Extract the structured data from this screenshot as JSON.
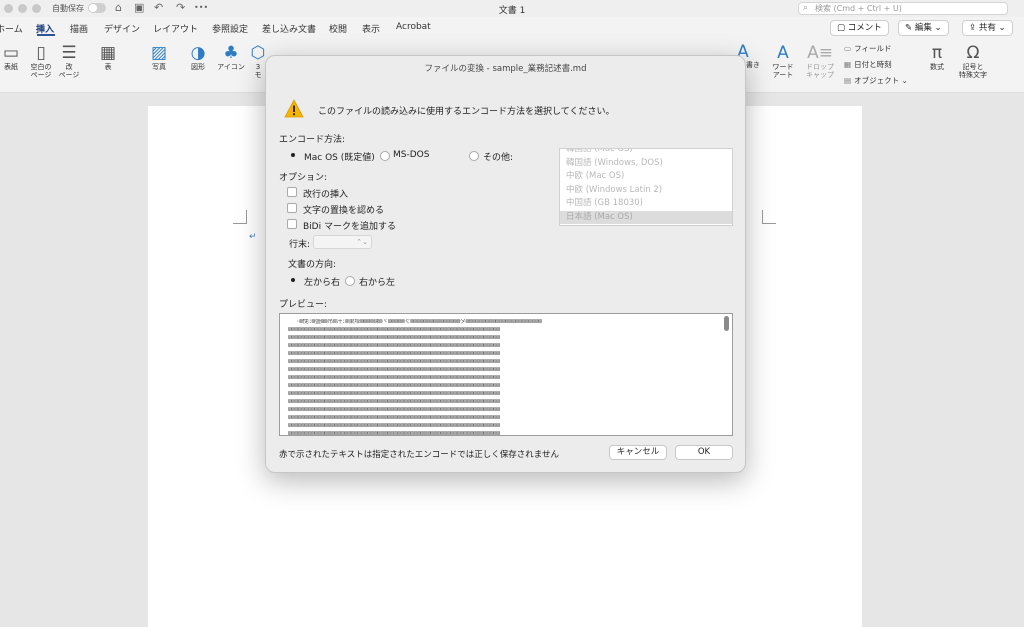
{
  "titlebar": {
    "autosave_label": "自動保存",
    "doc_title": "文書 1",
    "search_placeholder": "検索 (Cmd + Ctrl + U)"
  },
  "tabs": [
    "ホーム",
    "挿入",
    "描画",
    "デザイン",
    "レイアウト",
    "参照設定",
    "差し込み文書",
    "校閲",
    "表示",
    "Acrobat"
  ],
  "active_tab": "挿入",
  "ribbon_buttons": {
    "comment": "コメント",
    "edit": "編集",
    "share": "共有"
  },
  "ribbon": {
    "items": [
      {
        "label": "表紙",
        "icon": "cover-page-icon"
      },
      {
        "label": "空白の\nページ",
        "icon": "blank-page-icon"
      },
      {
        "label": "改\nページ",
        "icon": "page-break-icon"
      },
      {
        "label": "表",
        "icon": "table-icon"
      },
      {
        "label": "写真",
        "icon": "photo-icon"
      },
      {
        "label": "図形",
        "icon": "shapes-icon"
      },
      {
        "label": "アイコン",
        "icon": "icons-icon"
      },
      {
        "label": "3\nモ",
        "icon": "3d-model-icon"
      },
      {
        "label": "書き",
        "icon": "text-box-icon"
      },
      {
        "label": "ワード\nアート",
        "icon": "wordart-icon"
      },
      {
        "label": "ドロップ\nキャップ",
        "icon": "drop-cap-icon"
      },
      {
        "label": "数式",
        "icon": "equation-icon"
      },
      {
        "label": "記号と\n特殊文字",
        "icon": "symbol-icon"
      }
    ],
    "side_items": {
      "field": "フィールド",
      "date_time": "日付と時刻",
      "object": "オブジェクト"
    }
  },
  "dialog": {
    "title": "ファイルの変換 - sample_業務記述書.md",
    "message": "このファイルの読み込みに使用するエンコード方法を選択してください。",
    "encoding_label": "エンコード方法:",
    "encoding_options": [
      "Mac OS (既定値)",
      "MS-DOS",
      "その他:"
    ],
    "encoding_selected": "Mac OS (既定値)",
    "encoding_list": [
      "韓国語 (Mac OS)",
      "韓国語 (Windows, DOS)",
      "中欧 (Mac OS)",
      "中欧 (Windows Latin 2)",
      "中国語 (GB 18030)",
      "日本語 (Mac OS)"
    ],
    "encoding_list_selected": "日本語 (Mac OS)",
    "options_label": "オプション:",
    "options": [
      "改行の挿入",
      "文字の置換を認める",
      "BiDi マークを追加する"
    ],
    "line_end_label": "行末:",
    "direction_label": "文書の方向:",
    "direction_options": [
      "左から右",
      "右から左"
    ],
    "direction_selected": "左から右",
    "preview_label": "プレビュー:",
    "preview_lines": [
      "·⊠俛:⊠盛⊠⊠吊⊠汁:⊠巣埠⊠⊠⊠⊠錬⊠ヾ⊠⊠⊠⊠⊠ぐ⊠⊠⊠⊠⊠⊠⊠⊠⊠⊠⊠⊠⊠⊠⊠ダ⊠⊠⊠⊠⊠⊠⊠⊠⊠⊠⊠⊠⊠⊠⊠⊠⊠⊠⊠⊠⊠⊠⊠",
      "⊠⊠⊠⊠⊠⊠⊠⊠⊠⊠⊠⊠⊠⊠⊠⊠⊠⊠⊠⊠⊠⊠⊠⊠⊠⊠⊠⊠⊠⊠⊠⊠⊠⊠⊠⊠⊠⊠⊠⊠⊠⊠⊠⊠⊠⊠⊠⊠⊠⊠⊠⊠⊠⊠⊠⊠⊠⊠⊠⊠⊠⊠⊠⊠",
      "⊠⊠⊠⊠⊠⊠⊠⊠⊠⊠⊠⊠⊠⊠⊠⊠⊠⊠⊠⊠⊠⊠⊠⊠⊠⊠⊠⊠⊠⊠⊠⊠⊠⊠⊠⊠⊠⊠⊠⊠⊠⊠⊠⊠⊠⊠⊠⊠⊠⊠⊠⊠⊠⊠⊠⊠⊠⊠⊠⊠⊠⊠⊠⊠",
      "⊠⊠⊠⊠⊠⊠⊠⊠⊠⊠⊠⊠⊠⊠⊠⊠⊠⊠⊠⊠⊠⊠⊠⊠⊠⊠⊠⊠⊠⊠⊠⊠⊠⊠⊠⊠⊠⊠⊠⊠⊠⊠⊠⊠⊠⊠⊠⊠⊠⊠⊠⊠⊠⊠⊠⊠⊠⊠⊠⊠⊠⊠⊠⊠",
      "⊠⊠⊠⊠⊠⊠⊠⊠⊠⊠⊠⊠⊠⊠⊠⊠⊠⊠⊠⊠⊠⊠⊠⊠⊠⊠⊠⊠⊠⊠⊠⊠⊠⊠⊠⊠⊠⊠⊠⊠⊠⊠⊠⊠⊠⊠⊠⊠⊠⊠⊠⊠⊠⊠⊠⊠⊠⊠⊠⊠⊠⊠⊠⊠",
      "⊠⊠⊠⊠⊠⊠⊠⊠⊠⊠⊠⊠⊠⊠⊠⊠⊠⊠⊠⊠⊠⊠⊠⊠⊠⊠⊠⊠⊠⊠⊠⊠⊠⊠⊠⊠⊠⊠⊠⊠⊠⊠⊠⊠⊠⊠⊠⊠⊠⊠⊠⊠⊠⊠⊠⊠⊠⊠⊠⊠⊠⊠⊠⊠",
      "⊠⊠⊠⊠⊠⊠⊠⊠⊠⊠⊠⊠⊠⊠⊠⊠⊠⊠⊠⊠⊠⊠⊠⊠⊠⊠⊠⊠⊠⊠⊠⊠⊠⊠⊠⊠⊠⊠⊠⊠⊠⊠⊠⊠⊠⊠⊠⊠⊠⊠⊠⊠⊠⊠⊠⊠⊠⊠⊠⊠⊠⊠⊠⊠",
      "⊠⊠⊠⊠⊠⊠⊠⊠⊠⊠⊠⊠⊠⊠⊠⊠⊠⊠⊠⊠⊠⊠⊠⊠⊠⊠⊠⊠⊠⊠⊠⊠⊠⊠⊠⊠⊠⊠⊠⊠⊠⊠⊠⊠⊠⊠⊠⊠⊠⊠⊠⊠⊠⊠⊠⊠⊠⊠⊠⊠⊠⊠⊠⊠",
      "⊠⊠⊠⊠⊠⊠⊠⊠⊠⊠⊠⊠⊠⊠⊠⊠⊠⊠⊠⊠⊠⊠⊠⊠⊠⊠⊠⊠⊠⊠⊠⊠⊠⊠⊠⊠⊠⊠⊠⊠⊠⊠⊠⊠⊠⊠⊠⊠⊠⊠⊠⊠⊠⊠⊠⊠⊠⊠⊠⊠⊠⊠⊠⊠",
      "⊠⊠⊠⊠⊠⊠⊠⊠⊠⊠⊠⊠⊠⊠⊠⊠⊠⊠⊠⊠⊠⊠⊠⊠⊠⊠⊠⊠⊠⊠⊠⊠⊠⊠⊠⊠⊠⊠⊠⊠⊠⊠⊠⊠⊠⊠⊠⊠⊠⊠⊠⊠⊠⊠⊠⊠⊠⊠⊠⊠⊠⊠⊠⊠",
      "⊠⊠⊠⊠⊠⊠⊠⊠⊠⊠⊠⊠⊠⊠⊠⊠⊠⊠⊠⊠⊠⊠⊠⊠⊠⊠⊠⊠⊠⊠⊠⊠⊠⊠⊠⊠⊠⊠⊠⊠⊠⊠⊠⊠⊠⊠⊠⊠⊠⊠⊠⊠⊠⊠⊠⊠⊠⊠⊠⊠⊠⊠⊠⊠",
      "⊠⊠⊠⊠⊠⊠⊠⊠⊠⊠⊠⊠⊠⊠⊠⊠⊠⊠⊠⊠⊠⊠⊠⊠⊠⊠⊠⊠⊠⊠⊠⊠⊠⊠⊠⊠⊠⊠⊠⊠⊠⊠⊠⊠⊠⊠⊠⊠⊠⊠⊠⊠⊠⊠⊠⊠⊠⊠⊠⊠⊠⊠⊠⊠",
      "⊠⊠⊠⊠⊠⊠⊠⊠⊠⊠⊠⊠⊠⊠⊠⊠⊠⊠⊠⊠⊠⊠⊠⊠⊠⊠⊠⊠⊠⊠⊠⊠⊠⊠⊠⊠⊠⊠⊠⊠⊠⊠⊠⊠⊠⊠⊠⊠⊠⊠⊠⊠⊠⊠⊠⊠⊠⊠⊠⊠⊠⊠⊠⊠",
      "⊠⊠⊠⊠⊠⊠⊠⊠⊠⊠⊠⊠⊠⊠⊠⊠⊠⊠⊠⊠⊠⊠⊠⊠⊠⊠⊠⊠⊠⊠⊠⊠⊠⊠⊠⊠⊠⊠⊠⊠⊠⊠⊠⊠⊠⊠⊠⊠⊠⊠⊠⊠⊠⊠⊠⊠⊠⊠⊠⊠⊠⊠⊠⊠",
      "⊠⊠⊠⊠⊠⊠⊠⊠⊠⊠⊠⊠⊠⊠⊠⊠⊠⊠⊠⊠⊠⊠⊠⊠⊠⊠⊠⊠⊠⊠⊠⊠⊠⊠⊠⊠⊠⊠⊠⊠⊠⊠⊠⊠⊠⊠⊠⊠⊠⊠⊠⊠⊠⊠⊠⊠⊠⊠⊠⊠⊠⊠⊠⊠"
    ],
    "footer_note": "赤で示されたテキストは指定されたエンコードでは正しく保存されません",
    "cancel_label": "キャンセル",
    "ok_label": "OK"
  },
  "colors": {
    "accent": "#2b579a",
    "warning": "#f5b400"
  }
}
